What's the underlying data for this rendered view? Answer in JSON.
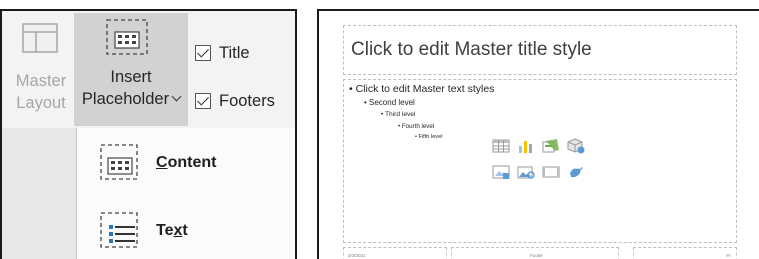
{
  "ribbon": {
    "master_layout": {
      "line1": "Master",
      "line2": "Layout",
      "icon": "slide-layout-icon"
    },
    "insert_placeholder": {
      "line1": "Insert",
      "line2": "Placeholder",
      "icon": "insert-placeholder-icon",
      "dropdown_icon": "chevron-down-icon"
    },
    "checkboxes": [
      {
        "label": "Title",
        "checked": true
      },
      {
        "label": "Footers",
        "checked": true
      }
    ]
  },
  "placeholder_menu": {
    "items": [
      {
        "label_mnemonic": "C",
        "label_rest": "ontent",
        "label": "Content",
        "icon": "content-placeholder-icon"
      },
      {
        "label_pre": "Te",
        "label_mnemonic": "x",
        "label_post": "t",
        "label": "Text",
        "icon": "text-placeholder-icon"
      }
    ]
  },
  "slide": {
    "title": "Click to edit Master title style",
    "body_levels": [
      "• Click to edit Master text styles",
      "• Second level",
      "• Third level",
      "• Fourth level",
      "• Fifth level"
    ],
    "content_icons": [
      "insert-table-icon",
      "insert-chart-icon",
      "insert-smartart-icon",
      "insert-3d-model-icon",
      "insert-picture-icon",
      "insert-online-picture-icon",
      "insert-video-icon",
      "insert-icons-icon"
    ],
    "footer": {
      "date": "3/3/2021",
      "text": "Footer",
      "number": "‹#›"
    }
  },
  "colors": {
    "ribbon_bg": "#f3f3f3",
    "selected_button_bg": "#d2d2d2",
    "menu_bg": "#fbfbfb",
    "placeholder_border": "#bfbfbf",
    "icon_blue": "#2e75b6"
  }
}
